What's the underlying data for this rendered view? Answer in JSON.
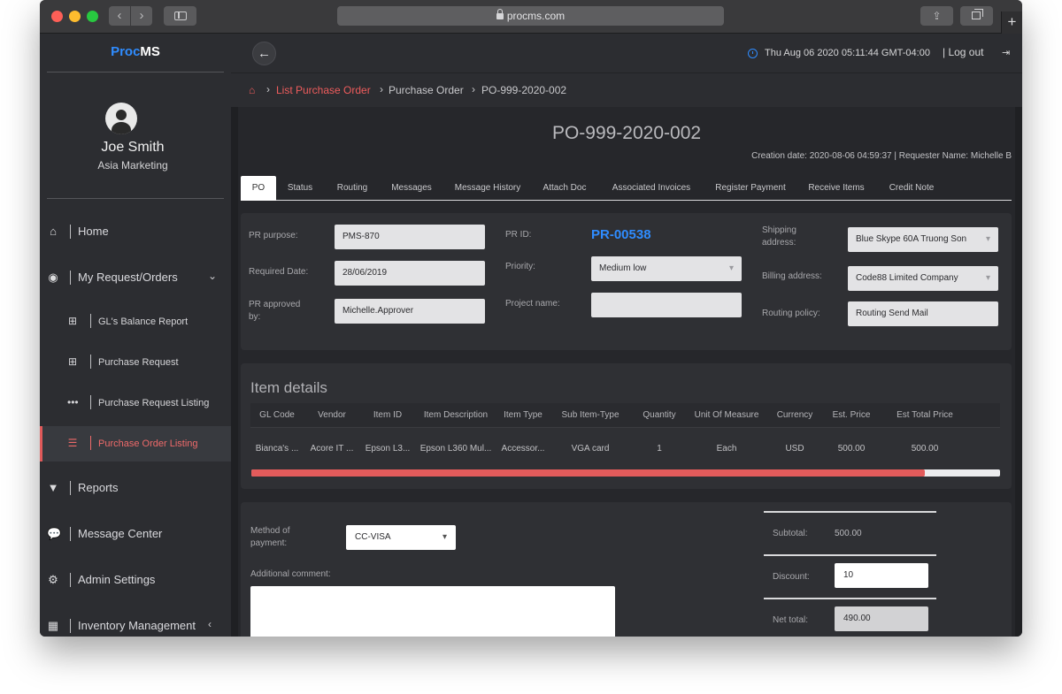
{
  "browser": {
    "url": "procms.com"
  },
  "app": {
    "logo_part1": "Proc",
    "logo_part2": "MS"
  },
  "user": {
    "name": "Joe Smith",
    "department": "Asia Marketing"
  },
  "sidebar": {
    "items": [
      {
        "label": "Home",
        "icon": "home-icon"
      },
      {
        "label": "My Request/Orders",
        "icon": "target-icon"
      },
      {
        "label": "GL's Balance Report",
        "icon": "plus-square-icon"
      },
      {
        "label": "Purchase Request",
        "icon": "plus-square-icon"
      },
      {
        "label": "Purchase Request Listing",
        "icon": "ellipsis-icon"
      },
      {
        "label": "Purchase Order Listing",
        "icon": "list-icon"
      },
      {
        "label": "Reports",
        "icon": "filter-icon"
      },
      {
        "label": "Message Center",
        "icon": "chat-icon"
      },
      {
        "label": "Admin Settings",
        "icon": "gears-icon"
      },
      {
        "label": "Inventory Management",
        "icon": "building-icon"
      }
    ]
  },
  "topbar": {
    "datetime": "Thu Aug 06 2020 05:11:44 GMT-04:00",
    "logout": "Log out"
  },
  "breadcrumb": {
    "items": [
      "List Purchase Order",
      "Purchase Order",
      "PO-999-2020-002"
    ]
  },
  "po": {
    "title": "PO-999-2020-002",
    "meta": "Creation date: 2020-08-06 04:59:37 | Requester Name: Michelle B"
  },
  "tabs": [
    "PO",
    "Status",
    "Routing",
    "Messages",
    "Message History",
    "Attach Doc",
    "Associated Invoices",
    "Register Payment",
    "Receive Items",
    "Credit Note"
  ],
  "form": {
    "pr_purpose_label": "PR purpose:",
    "pr_purpose": "PMS-870",
    "required_date_label": "Required Date:",
    "required_date": "28/06/2019",
    "approved_by_label_1": "PR approved",
    "approved_by_label_2": "by:",
    "approved_by": "Michelle.Approver",
    "pr_id_label": "PR ID:",
    "pr_id": "PR-00538",
    "priority_label": "Priority:",
    "priority": "Medium low",
    "project_name_label": "Project name:",
    "project_name": "",
    "shipping_label_1": "Shipping",
    "shipping_label_2": "address:",
    "shipping_address": "Blue Skype 60A Truong Son",
    "billing_label": "Billing address:",
    "billing_address": "Code88 Limited Company",
    "routing_label": "Routing policy:",
    "routing_policy": "Routing Send Mail"
  },
  "items": {
    "title": "Item details",
    "columns": [
      "GL Code",
      "Vendor",
      "Item ID",
      "Item Description",
      "Item Type",
      "Sub Item-Type",
      "Quantity",
      "Unit Of Measure",
      "Currency",
      "Est. Price",
      "Est Total Price"
    ],
    "rows": [
      [
        "Bianca's ...",
        "Acore IT ...",
        "Epson L3...",
        "Epson L360 Mul...",
        "Accessor...",
        "VGA card",
        "1",
        "Each",
        "USD",
        "500.00",
        "500.00"
      ]
    ],
    "scroll_fraction": 0.9
  },
  "payment": {
    "method_label_1": "Method of",
    "method_label_2": "payment:",
    "method": "CC-VISA",
    "comment_label": "Additional comment:",
    "comment": ""
  },
  "summary": {
    "subtotal_label": "Subtotal:",
    "subtotal": "500.00",
    "discount_label": "Discount:",
    "discount": "10",
    "net_total_label": "Net total:",
    "net_total": "490.00"
  },
  "colors": {
    "accent_blue": "#2f8cff",
    "accent_red": "#ee5c5c"
  }
}
